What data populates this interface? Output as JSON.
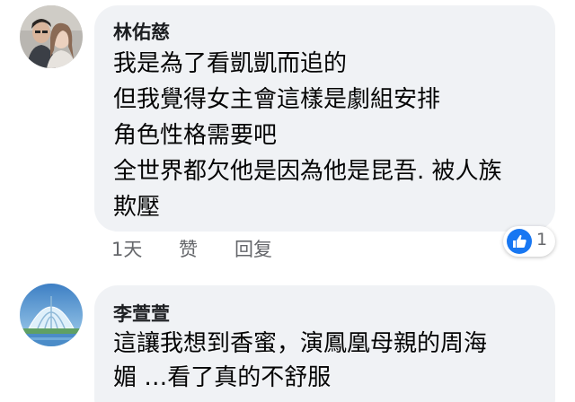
{
  "comments": [
    {
      "author": "林佑慈",
      "lines": [
        "我是為了看凱凱而追的",
        "但我覺得女主會這樣是劇組安排",
        "角色性格需要吧",
        "全世界都欠他是因為他是昆吾. 被人族",
        "欺壓"
      ],
      "actions": {
        "time": "1天",
        "like": "赞",
        "reply": "回复"
      },
      "reactions": {
        "icon": "thumbs-up-icon",
        "count": "1",
        "color": "#1877f2"
      },
      "avatar": "avatar-photo-couple"
    },
    {
      "author": "李萱萱",
      "lines": [
        "這讓我想到香蜜，演鳳凰母親的周海",
        "媚 …看了真的不舒服"
      ],
      "avatar": "avatar-photo-glass-building"
    }
  ],
  "colors": {
    "bubble": "#f0f2f5",
    "text": "#050505",
    "meta": "#65676b",
    "like_blue": "#1877f2"
  }
}
